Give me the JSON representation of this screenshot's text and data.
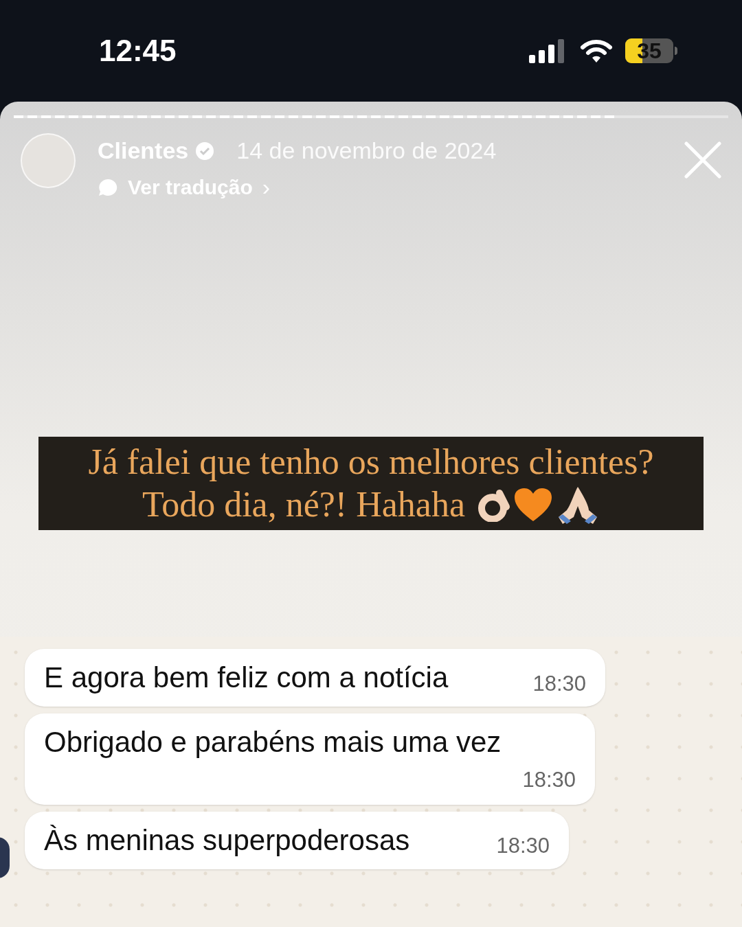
{
  "status_bar": {
    "time": "12:45",
    "battery": "35"
  },
  "story": {
    "progress": {
      "level": 0.84
    },
    "account": "Clientes",
    "date": "14 de novembro de 2024",
    "translate_link": "Ver tradução",
    "chevron": "›"
  },
  "caption": {
    "lines": [
      "Já falei que tenho os melhores clientes?",
      "Todo dia, né?! Hahaha"
    ]
  },
  "messages": [
    {
      "text": "E agora bem feliz com a notícia",
      "time": "18:30",
      "wrap": false
    },
    {
      "text": "Obrigado e parabéns mais uma vez",
      "time": "18:30",
      "wrap": true
    },
    {
      "text": "Às meninas superpoderosas",
      "time": "18:30",
      "wrap": false
    }
  ]
}
